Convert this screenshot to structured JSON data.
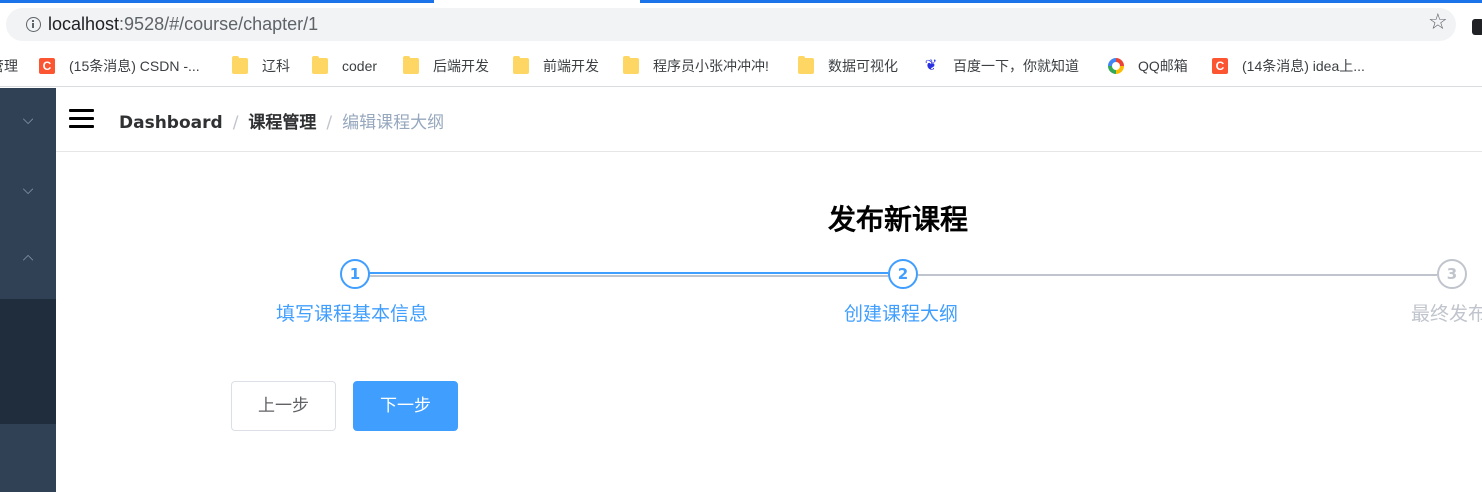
{
  "browser": {
    "url_host": "localhost",
    "url_rest": ":9528/#/course/chapter/1",
    "bookmarks": [
      {
        "label": "管理",
        "icon": "none"
      },
      {
        "label": "(15条消息) CSDN -...",
        "icon": "csdn-icon"
      },
      {
        "label": "辽科",
        "icon": "folder-icon"
      },
      {
        "label": "coder",
        "icon": "folder-icon"
      },
      {
        "label": "后端开发",
        "icon": "folder-icon"
      },
      {
        "label": "前端开发",
        "icon": "folder-icon"
      },
      {
        "label": "程序员小张冲冲冲!",
        "icon": "folder-icon"
      },
      {
        "label": "数据可视化",
        "icon": "folder-icon"
      },
      {
        "label": "百度一下，你就知道",
        "icon": "baidu-icon"
      },
      {
        "label": "QQ邮箱",
        "icon": "qq-mail-icon"
      },
      {
        "label": "(14条消息) idea上...",
        "icon": "csdn-icon"
      }
    ]
  },
  "breadcrumb": {
    "items": [
      "Dashboard",
      "课程管理",
      "编辑课程大纲"
    ],
    "separator": "/"
  },
  "page": {
    "title": "发布新课程"
  },
  "steps": [
    {
      "number": "1",
      "label": "填写课程基本信息",
      "status": "finished"
    },
    {
      "number": "2",
      "label": "创建课程大纲",
      "status": "active"
    },
    {
      "number": "3",
      "label": "最终发布",
      "status": "wait"
    }
  ],
  "buttons": {
    "prev": "上一步",
    "next": "下一步"
  },
  "colors": {
    "accent": "#409eff",
    "sidebar": "#304156",
    "sidebar_active": "#1f2d3d",
    "muted": "#c0c4cc"
  }
}
